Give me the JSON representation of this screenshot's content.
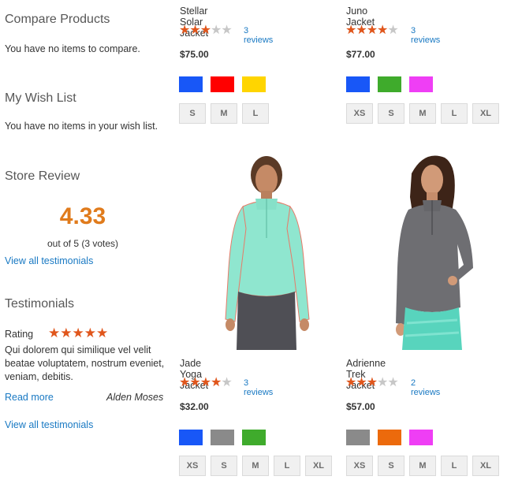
{
  "sidebar": {
    "compare": {
      "title": "Compare Products",
      "text": "You have no items to compare."
    },
    "wishlist": {
      "title": "My Wish List",
      "text": "You have no items in your wish list."
    },
    "store_review": {
      "title": "Store Review",
      "score": "4.33",
      "summary": "out of 5 (3 votes)",
      "link": "View all testimonials"
    },
    "testimonials": {
      "title": "Testimonials",
      "rating_label": "Rating",
      "stars": "★★★★★",
      "text": "Qui dolorem qui similique vel velit beatae voluptatem, nostrum eveniet, veniam, debitis.",
      "read_more": "Read more",
      "author": "Alden Moses",
      "link": "View all testimonials"
    }
  },
  "products": [
    {
      "name": "Stellar Solar Jacket",
      "stars_on": "★★★",
      "stars_off": "★★",
      "rating": 3.5,
      "reviews": "3 reviews",
      "price": "$75.00",
      "colors": [
        "#1857f7",
        "#ff0000",
        "#ffd500"
      ],
      "sizes": [
        "S",
        "M",
        "L"
      ]
    },
    {
      "name": "Juno Jacket",
      "stars_on": "★★★★",
      "stars_off": "★",
      "rating": 4.5,
      "reviews": "3 reviews",
      "price": "$77.00",
      "colors": [
        "#1857f7",
        "#3fab2c",
        "#ef3ef5"
      ],
      "sizes": [
        "XS",
        "S",
        "M",
        "L",
        "XL"
      ]
    },
    {
      "name": "Jade Yoga Jacket",
      "stars_on": "★★★★",
      "stars_off": "★",
      "rating": 4.5,
      "reviews": "3 reviews",
      "price": "$32.00",
      "colors": [
        "#1857f7",
        "#8a8a8a",
        "#3fab2c"
      ],
      "sizes": [
        "XS",
        "S",
        "M",
        "L",
        "XL"
      ]
    },
    {
      "name": "Adrienne Trek Jacket",
      "stars_on": "★★★",
      "stars_off": "★★",
      "rating": 3,
      "reviews": "2 reviews",
      "price": "$57.00",
      "colors": [
        "#8a8a8a",
        "#ec6a0c",
        "#ef3ef5"
      ],
      "sizes": [
        "XS",
        "S",
        "M",
        "L",
        "XL"
      ]
    }
  ],
  "colors": {
    "link": "#1979c3",
    "star": "#e0561c",
    "score": "#e07b1c"
  }
}
